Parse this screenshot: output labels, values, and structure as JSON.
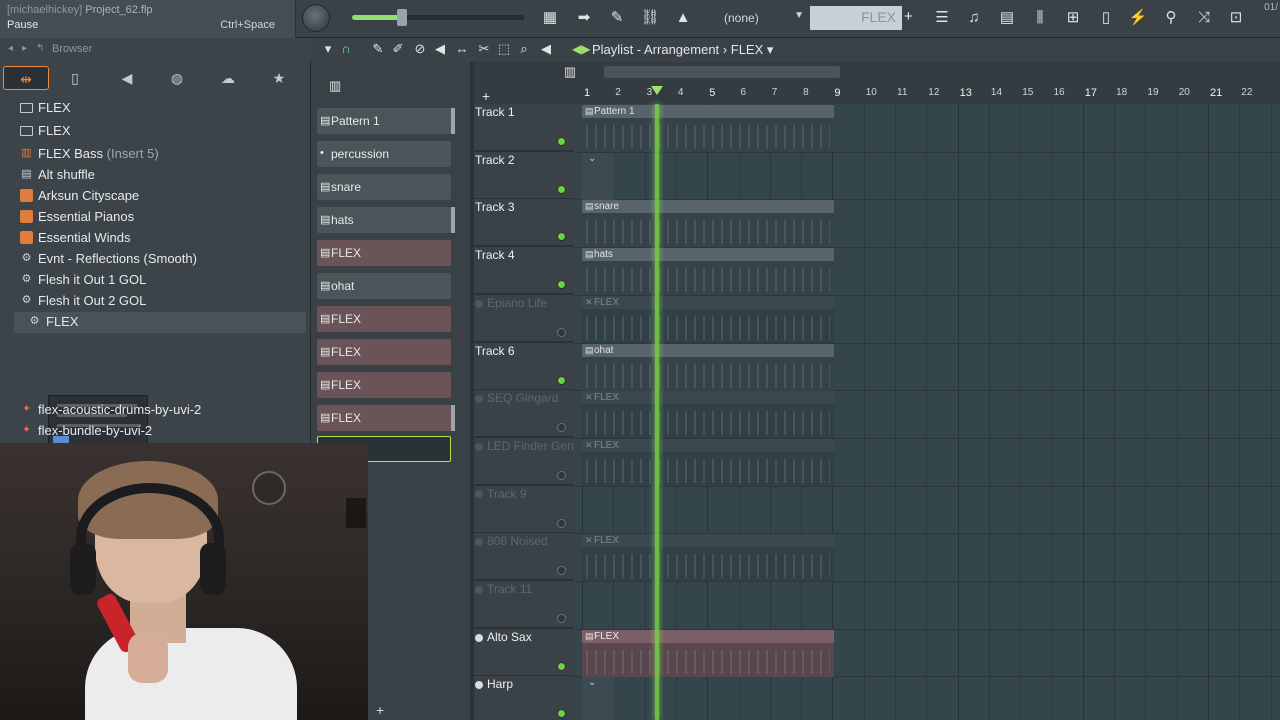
{
  "titlebar": {
    "user": "[michaelhickey]",
    "project": "Project_62.flp",
    "hint": "Pause",
    "shortcut": "Ctrl+Space"
  },
  "toolbar": {
    "pattern_select": "(none)",
    "pattern_name": "FLEX",
    "add_symbol": "+",
    "time_readout": "01/"
  },
  "browser": {
    "label": "Browser",
    "items": [
      {
        "label": "FLEX",
        "icon": "folder-icon"
      },
      {
        "label": "FLEX",
        "icon": "folder-icon"
      },
      {
        "label": "FLEX Bass",
        "sub": "(Insert 5)",
        "icon": "channel-icon"
      },
      {
        "label": "Alt shuffle",
        "icon": "pattern-icon"
      },
      {
        "label": "Arksun Cityscape",
        "icon": "plugin-icon"
      },
      {
        "label": "Essential Pianos",
        "icon": "plugin-icon"
      },
      {
        "label": "Essential Winds",
        "icon": "plugin-icon"
      },
      {
        "label": "Evnt - Reflections (Smooth)",
        "icon": "gear-icon"
      },
      {
        "label": "Flesh it Out 1 GOL",
        "icon": "gear-icon"
      },
      {
        "label": "Flesh it Out 2 GOL",
        "icon": "gear-icon"
      },
      {
        "label": "FLEX",
        "icon": "gear-icon"
      },
      {
        "label": "flex-acoustic-drums-by-uvi-2",
        "icon": "tool-icon"
      },
      {
        "label": "flex-bundle-by-uvi-2",
        "icon": "tool-icon"
      }
    ]
  },
  "channels": [
    {
      "label": "Pattern 1",
      "type": "pattern"
    },
    {
      "label": "percussion",
      "type": "dot"
    },
    {
      "label": "snare",
      "type": "pattern"
    },
    {
      "label": "hats",
      "type": "pattern"
    },
    {
      "label": "FLEX",
      "type": "audio"
    },
    {
      "label": "ohat",
      "type": "pattern"
    },
    {
      "label": "FLEX",
      "type": "audio"
    },
    {
      "label": "FLEX",
      "type": "audio"
    },
    {
      "label": "FLEX",
      "type": "audio"
    },
    {
      "label": "FLEX",
      "type": "audio"
    }
  ],
  "playlist": {
    "title": "Playlist - Arrangement",
    "separator": "›",
    "pattern": "FLEX",
    "ruler": [
      "1",
      "2",
      "3",
      "4",
      "5",
      "6",
      "7",
      "8",
      "9",
      "10",
      "11",
      "12",
      "13",
      "14",
      "15",
      "16",
      "17",
      "18",
      "19",
      "20",
      "21",
      "22"
    ],
    "tracks": [
      {
        "name": "Track 1",
        "dim": false
      },
      {
        "name": "Track 2",
        "dim": false
      },
      {
        "name": "Track 3",
        "dim": false
      },
      {
        "name": "Track 4",
        "dim": false
      },
      {
        "name": "Epiano Life",
        "dim": true
      },
      {
        "name": "Track 6",
        "dim": false
      },
      {
        "name": "SEQ Gingard",
        "dim": true
      },
      {
        "name": "LED Finder Gera",
        "dim": true
      },
      {
        "name": "Track 9",
        "dim": true
      },
      {
        "name": "808 Noised",
        "dim": true
      },
      {
        "name": "Track 11",
        "dim": true
      },
      {
        "name": "Alto Sax",
        "dim": false
      },
      {
        "name": "Harp",
        "dim": false
      }
    ],
    "clips": [
      {
        "label": "Pattern 1",
        "kind": "pattern"
      },
      {
        "label": "snare",
        "kind": "pattern"
      },
      {
        "label": "hats",
        "kind": "pattern"
      },
      {
        "label": "FLEX",
        "kind": "muted"
      },
      {
        "label": "ohat",
        "kind": "pattern"
      },
      {
        "label": "FLEX",
        "kind": "muted"
      },
      {
        "label": "FLEX",
        "kind": "muted"
      },
      {
        "label": "FLEX",
        "kind": "muted"
      },
      {
        "label": "FLEX",
        "kind": "audio"
      }
    ]
  },
  "colors": {
    "accent_green": "#9fe06e",
    "browser_accent": "#f0883a",
    "audio_clip": "#7a5f66"
  }
}
